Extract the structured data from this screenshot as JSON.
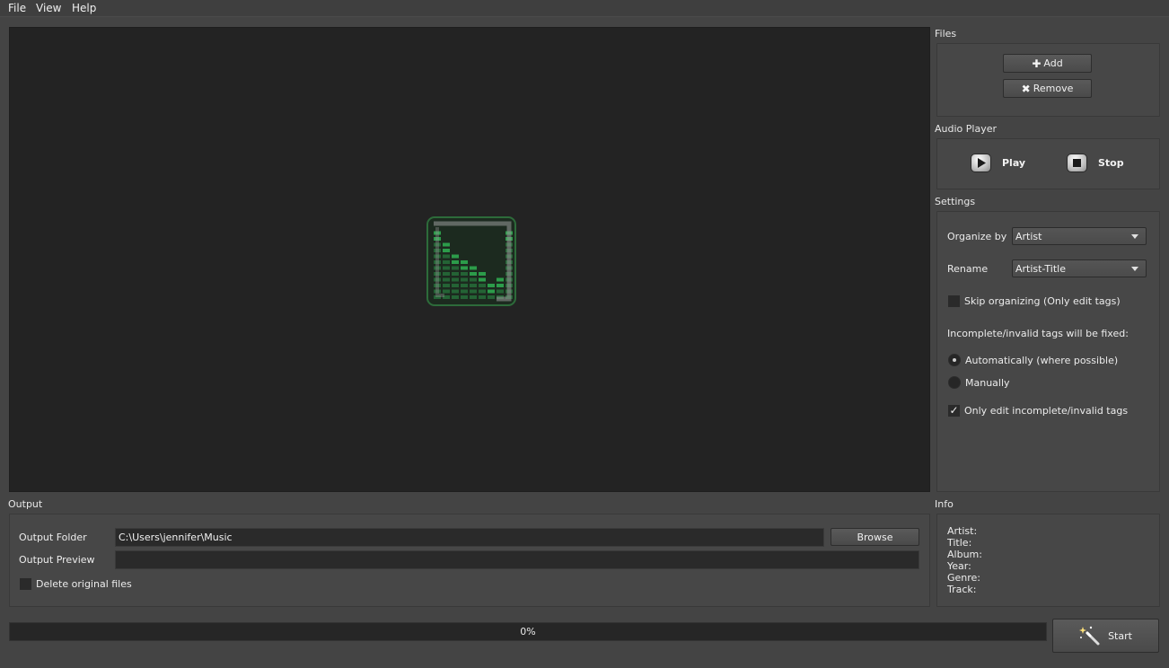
{
  "menu": [
    "File",
    "View",
    "Help"
  ],
  "files": {
    "title": "Files",
    "add_label": "Add",
    "remove_label": "Remove"
  },
  "audio_player": {
    "title": "Audio Player",
    "play_label": "Play",
    "stop_label": "Stop"
  },
  "settings": {
    "title": "Settings",
    "organize_by_label": "Organize by",
    "organize_by_value": "Artist",
    "rename_label": "Rename",
    "rename_value": "Artist-Title",
    "skip_organizing_label": "Skip organizing (Only edit tags)",
    "skip_organizing_checked": false,
    "fix_heading": "Incomplete/invalid tags will be fixed:",
    "auto_label": "Automatically (where possible)",
    "manual_label": "Manually",
    "fix_mode": "Automatically",
    "only_edit_label": "Only edit incomplete/invalid tags",
    "only_edit_checked": true
  },
  "output": {
    "title": "Output",
    "folder_label": "Output Folder",
    "folder_value": "C:\\Users\\jennifer\\Music",
    "browse_label": "Browse",
    "preview_label": "Output Preview",
    "preview_value": "",
    "delete_label": "Delete original files",
    "delete_checked": false
  },
  "info": {
    "title": "Info",
    "fields": [
      "Artist:",
      "Title:",
      "Album:",
      "Year:",
      "Genre:",
      "Track:"
    ]
  },
  "progress": {
    "value": 0,
    "text": "0%"
  },
  "start_label": "Start",
  "colors": {
    "background": "#444444",
    "panel": "#232323",
    "logo_green": "#2fa84f"
  },
  "icons": {
    "logo": "equalizer-music-logo-icon",
    "add": "plus-icon",
    "remove": "x-icon",
    "play": "play-icon",
    "stop": "stop-icon",
    "start": "magic-wand-icon"
  }
}
